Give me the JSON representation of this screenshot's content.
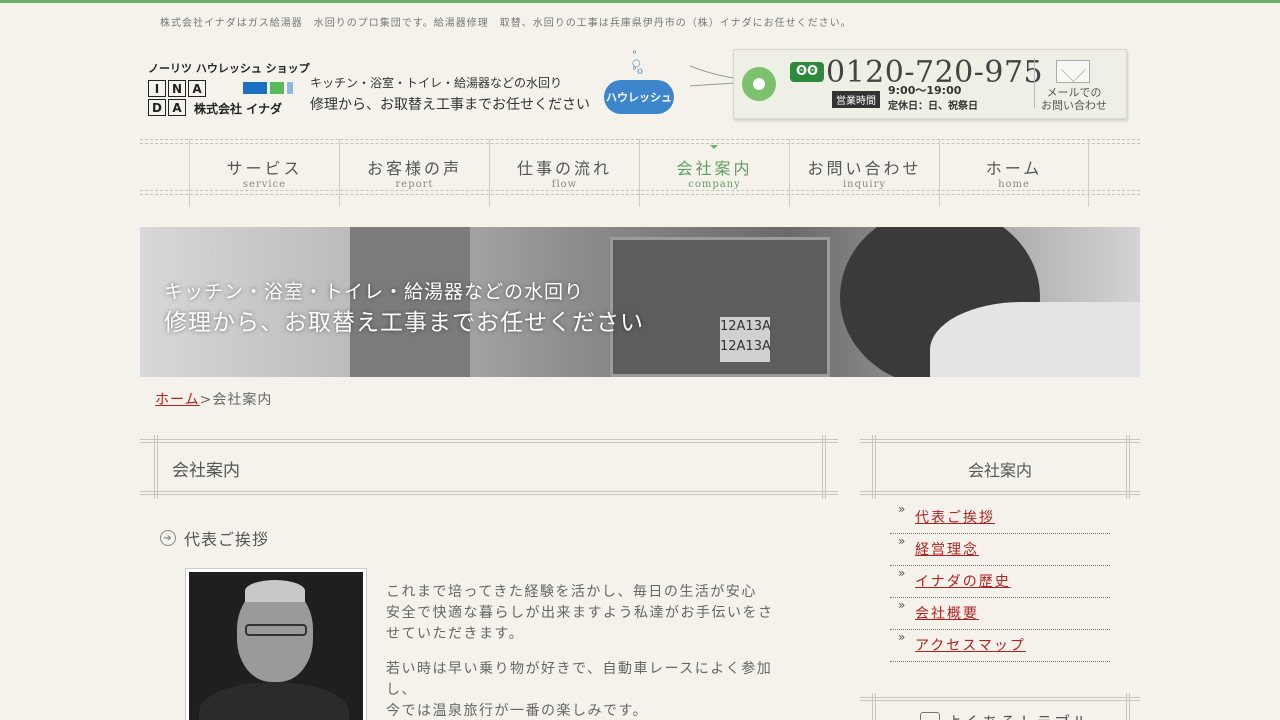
{
  "tagline": "株式会社イナダはガス給湯器　水回りのプロ集団です。給湯器修理　取替、水回りの工事は兵庫県伊丹市の（株）イナダにお任せください。",
  "logo": {
    "brand": "ノーリツ ハウレッシュ ショップ",
    "letters": [
      "I",
      "N",
      "A",
      "D",
      "A"
    ],
    "company": "株式会社 イナダ",
    "bar_colors": [
      "#1d6fc0",
      "#5cb85c",
      "#8fb8e0"
    ]
  },
  "header": {
    "lead1": "キッチン・浴室・トイレ・給湯器などの水回り",
    "lead2": "修理から、お取替え工事までお任せください",
    "reform_logo": "ハウレッシュ",
    "freedial_icon": "ʘʘ",
    "phone": "0120-720-975",
    "hours_badge": "営業時間",
    "hours": "9:00〜19:00",
    "holidays": "定休日：日、祝祭日",
    "mail_label": "メールでの\nお問い合わせ"
  },
  "nav": [
    {
      "jp": "サービス",
      "en": "service"
    },
    {
      "jp": "お客様の声",
      "en": "report"
    },
    {
      "jp": "仕事の流れ",
      "en": "flow"
    },
    {
      "jp": "会社案内",
      "en": "company"
    },
    {
      "jp": "お問い合わせ",
      "en": "inquiry"
    },
    {
      "jp": "ホーム",
      "en": "home"
    }
  ],
  "hero": {
    "line1": "キッチン・浴室・トイレ・給湯器などの水回り",
    "line2": "修理から、お取替え工事までお任せください",
    "plate": "12A13A\n12A13A"
  },
  "breadcrumb": {
    "home": "ホーム",
    "sep": ">",
    "current": "会社案内"
  },
  "main": {
    "title": "会社案内",
    "section_title": "代表ご挨拶",
    "para1": "これまで培ってきた経験を活かし、毎日の生活が安心　安全で快適な暮らしが出来ますよう私達がお手伝いをさせていただきます。",
    "para2": "若い時は早い乗り物が好きで、自動車レースによく参加し、\n今では温泉旅行が一番の楽しみです。"
  },
  "sidebar": {
    "title": "会社案内",
    "chevron": "»",
    "items": [
      {
        "label": "代表ご挨拶"
      },
      {
        "label": "経営理念"
      },
      {
        "label": "イナダの歴史"
      },
      {
        "label": "会社概要"
      },
      {
        "label": "アクセスマップ"
      }
    ],
    "next_title": "よくあるトラブル"
  },
  "colors": {
    "accent": "#5e9f60",
    "link": "#b22222",
    "background": "#f4f2ea"
  }
}
